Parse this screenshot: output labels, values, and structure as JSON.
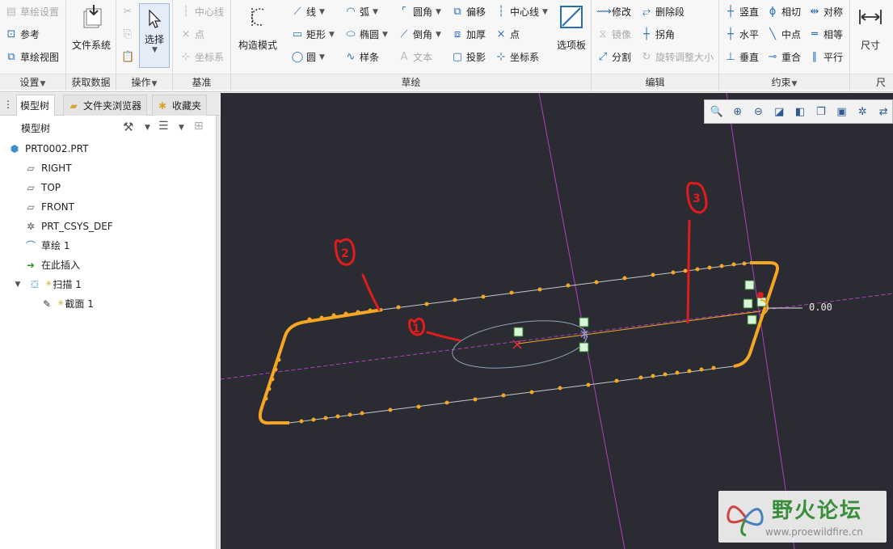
{
  "ribbon": {
    "setup": {
      "label": "设置",
      "items": [
        "草绘设置",
        "参考",
        "草绘视图"
      ]
    },
    "get_data": {
      "label": "获取数据",
      "file_system": "文件系统"
    },
    "operations": {
      "label": "操作",
      "select": "选择"
    },
    "datum": {
      "label": "基准",
      "items": [
        "中心线",
        "点",
        "坐标系"
      ]
    },
    "sketch": {
      "label": "草绘",
      "construction_mode": "构造模式",
      "palette": "选项板",
      "col1": [
        "线",
        "矩形",
        "圆"
      ],
      "col2": [
        "弧",
        "椭圆",
        "样条"
      ],
      "col3": [
        "圆角",
        "倒角",
        "文本"
      ],
      "col4": [
        "偏移",
        "加厚",
        "投影"
      ],
      "col5": [
        "中心线",
        "点",
        "坐标系"
      ]
    },
    "edit": {
      "label": "编辑",
      "col1": [
        "修改",
        "镜像",
        "分割"
      ],
      "col2": [
        "删除段",
        "拐角",
        "旋转调整大小"
      ]
    },
    "constrain": {
      "label": "约束",
      "col1": [
        "竖直",
        "水平",
        "垂直"
      ],
      "col2": [
        "相切",
        "中点",
        "重合"
      ],
      "col3": [
        "对称",
        "相等",
        "平行"
      ]
    },
    "dimension": {
      "label": "尺寸",
      "dimension": "尺寸"
    }
  },
  "tabs": [
    "模型树",
    "文件夹浏览器",
    "收藏夹"
  ],
  "panel": {
    "title": "模型树"
  },
  "tree": {
    "root": "PRT0002.PRT",
    "items": [
      "RIGHT",
      "TOP",
      "FRONT",
      "PRT_CSYS_DEF",
      "草绘 1",
      "在此插入",
      "扫描 1",
      "截面 1"
    ]
  },
  "canvas": {
    "dimension_value": "0.00",
    "annotations": [
      "1",
      "2",
      "3"
    ]
  },
  "watermark": {
    "title": "野火论坛",
    "url": "www.proewildfire.cn"
  },
  "colors": {
    "canvas_bg": "#2b2b33",
    "trajectory": "#f5a623",
    "datum_plane": "#b040c0",
    "annotation": "#e01c1c",
    "section": "#8fa3b8"
  }
}
